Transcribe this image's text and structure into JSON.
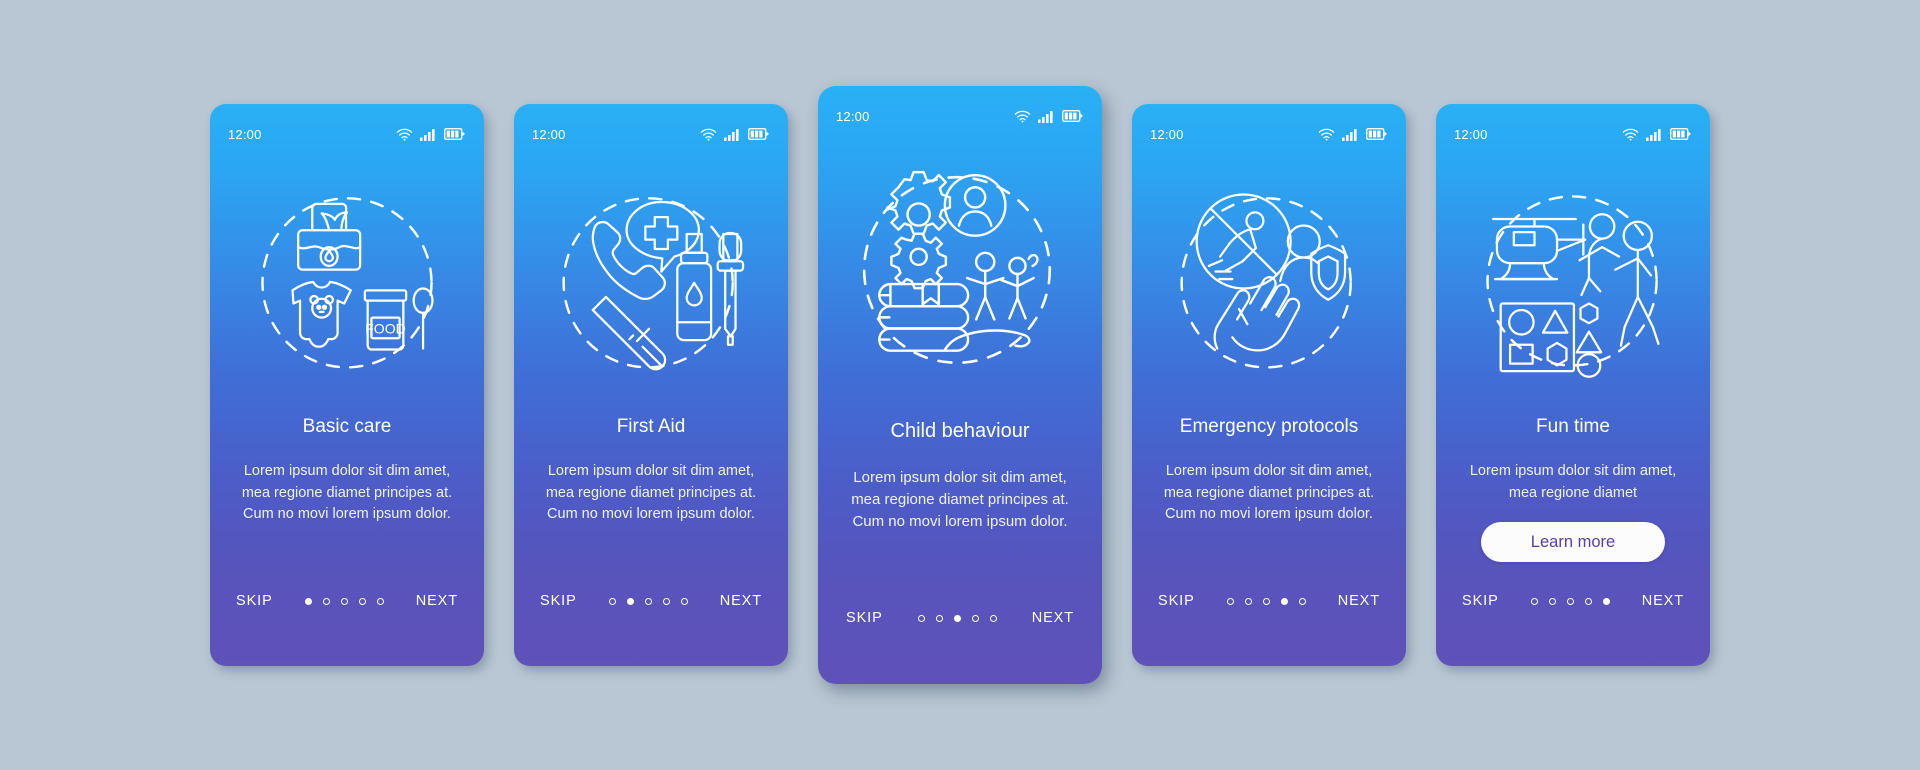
{
  "background_color": "#b9c6d3",
  "common": {
    "status_time": "12:00",
    "skip_label": "SKIP",
    "next_label": "NEXT",
    "wifi_icon": "wifi-icon",
    "signal_icon": "signal-bars-icon",
    "battery_icon": "battery-icon"
  },
  "colors": {
    "gradient_top": "#29b0f5",
    "gradient_bottom": "#5f52b8",
    "button_bg": "#fdfcfd",
    "button_text": "#5b3fa8",
    "text": "#ffffff"
  },
  "screens": [
    {
      "id": "basic-care",
      "title": "Basic care",
      "description": "Lorem ipsum dolor sit dim amet, mea regione diamet principes at. Cum no movi lorem ipsum dolor.",
      "illustration": "baby-wipes-onesie-food-jar-spoon-icon",
      "dots_total": 5,
      "active_dot": 1,
      "has_learn_more": false,
      "featured": false
    },
    {
      "id": "first-aid",
      "title": "First Aid",
      "description": "Lorem ipsum dolor sit dim amet, mea regione diamet principes at. Cum no movi lorem ipsum dolor.",
      "illustration": "phone-medical-cross-thermometer-dropper-icon",
      "dots_total": 5,
      "active_dot": 2,
      "has_learn_more": false,
      "featured": false
    },
    {
      "id": "child-behaviour",
      "title": "Child behaviour",
      "description": "Lorem ipsum dolor sit dim amet, mea regione diamet principes at. Cum no movi lorem ipsum dolor.",
      "illustration": "gears-person-books-children-hand-icon",
      "dots_total": 5,
      "active_dot": 3,
      "has_learn_more": false,
      "featured": true
    },
    {
      "id": "emergency-protocols",
      "title": "Emergency protocols",
      "description": "Lorem ipsum dolor sit dim amet, mea regione diamet principes at. Cum no movi lorem ipsum dolor.",
      "illustration": "no-falling-prohibition-person-shield-hands-icon",
      "dots_total": 5,
      "active_dot": 4,
      "has_learn_more": false,
      "featured": false
    },
    {
      "id": "fun-time",
      "title": "Fun time",
      "description": "Lorem ipsum dolor sit dim amet, mea regione diamet",
      "illustration": "helicopter-parent-child-shape-sorter-icon",
      "learn_more_label": "Learn more",
      "dots_total": 5,
      "active_dot": 5,
      "has_learn_more": true,
      "featured": false
    }
  ]
}
